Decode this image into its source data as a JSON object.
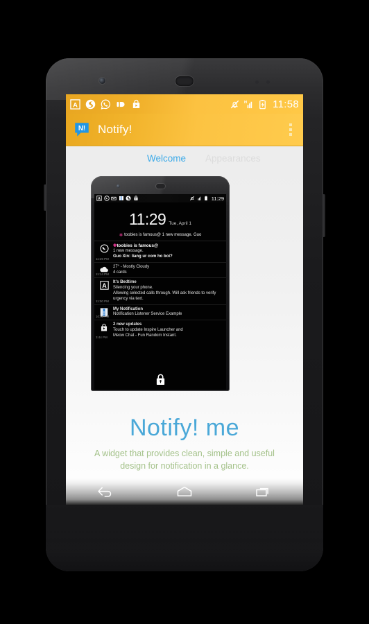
{
  "status_bar": {
    "left_icons": [
      "app-a-icon",
      "swoosh-icon",
      "whatsapp-icon",
      "pushbullet-icon",
      "play-store-icon"
    ],
    "right_icons": [
      "mute-bell-icon",
      "signal-h-icon",
      "battery-charging-icon"
    ],
    "time": "11:58"
  },
  "app_bar": {
    "logo": "notify-bubble-logo",
    "title": "Notify!",
    "overflow": "overflow-menu-icon"
  },
  "tabs": [
    {
      "label": "Welcome",
      "active": true
    },
    {
      "label": "Appearances",
      "active": false
    }
  ],
  "preview": {
    "status_bar": {
      "left_icons": [
        "app-a-icon",
        "whatsapp-icon",
        "mail-icon",
        "book-icon",
        "swoosh-icon",
        "play-store-icon"
      ],
      "right_icons": [
        "mute-bell-icon",
        "signal-icon",
        "battery-icon"
      ],
      "time": "11:29"
    },
    "clock": "11:29",
    "date": "Tue, April 1",
    "ticker": "toobies is famous@ 1 new message. Guo",
    "lock_icon": "lock-icon",
    "notifications": [
      {
        "icon": "whatsapp-icon",
        "timestamp": "11:29 PM",
        "line1": "toobies is famous@",
        "line2": "1 new message.",
        "line3": "Guo Xin: liang ur com ho boi?"
      },
      {
        "icon": "cloud-weather-icon",
        "timestamp": "11:14 PM",
        "line1": "27° - Mostly Cloudy",
        "line2": "4 cards",
        "line3": ""
      },
      {
        "icon": "app-a-icon",
        "timestamp": "11:00 PM",
        "line1": "It's Bedtime",
        "line2": "Silencing your phone.",
        "line3": "Allowing selected calls through. Will ask friends to verify urgency via text."
      },
      {
        "icon": "notification-listener-icon",
        "timestamp": "10:55 PM",
        "line1": "My Notification",
        "line2": "Notification Listener Service Example",
        "line3": ""
      },
      {
        "icon": "play-store-icon",
        "timestamp": "3:44 PM",
        "line1": "2 new updates",
        "line2": "Touch to update Inspire Launcher and",
        "line3": "Meow Chat - Fun Random Instant."
      }
    ]
  },
  "headline": "Notify! me",
  "subtitle": "A widget that provides clean, simple and useful design for notification in a glance.",
  "nav_bar": {
    "back": "back-nav-icon",
    "home": "home-nav-icon",
    "recents": "recents-nav-icon"
  },
  "colors": {
    "accent_amber": "#fcc342",
    "tab_active_blue": "#3aa9e8",
    "headline_blue": "#4aa8d8",
    "subtitle_green": "#a4c28a",
    "ticker_pink": "#ff3fa4"
  }
}
